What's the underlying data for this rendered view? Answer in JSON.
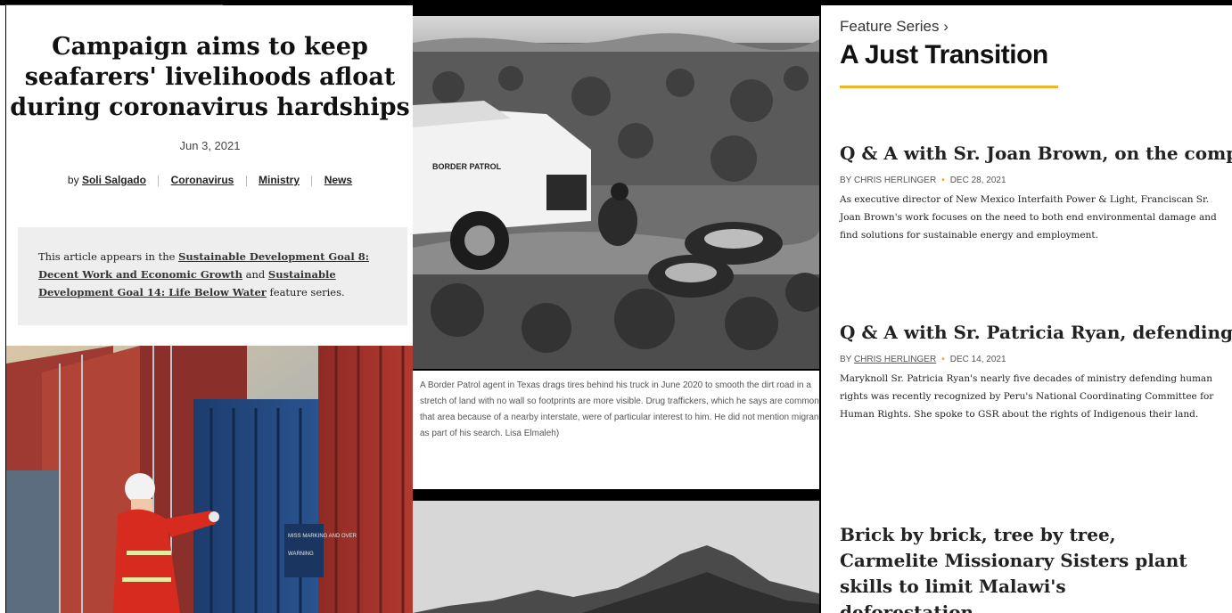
{
  "left_panel": {
    "headline": "Campaign aims to keep seafarers' livelihoods afloat during coronavirus hardships",
    "date": "Jun 3, 2021",
    "byline_prefix": "by",
    "author": "Soli Salgado",
    "tags": [
      "Coronavirus",
      "Ministry",
      "News"
    ],
    "notice": {
      "prefix": "This article appears in the",
      "link1": "Sustainable Development Goal 8: Decent Work and Economic Growth",
      "and": "and",
      "link2": "Sustainable Development Goal 14: Life Below Water",
      "suffix": "feature series."
    },
    "hero_text": {
      "sign1": "MISS MARKING AND OVER",
      "sign2": "WARNING"
    }
  },
  "middle_panel": {
    "truck_text": "BORDER PATROL",
    "caption": "A Border Patrol agent in Texas drags tires behind his truck in June 2020 to smooth the dirt road in a stretch of land with no wall so footprints are more visible. Drug traffickers, which he says are common in that area because of a nearby interstate, were of particular interest to him. He did not mention migrants as part of his search. Lisa Elmaleh)"
  },
  "right_panel": {
    "series_label": "Feature Series ›",
    "series_title": "A Just Transition",
    "accent_color": "#f0b429",
    "articles": [
      {
        "title": "Q & A with Sr. Joan Brown, on the complexities of the shift to sustainability",
        "author": "BY CHRIS HERLINGER",
        "date": "DEC 28, 2021",
        "excerpt": "As executive director of New Mexico Interfaith Power & Light, Franciscan Sr. Joan Brown's work focuses on the need to both end environmental damage and find solutions for sustainable energy and employment."
      },
      {
        "title": "Q & A with Sr. Patricia Ryan, defending Indigenous rights amid land exploitation",
        "author_prefix": "BY",
        "author_name": "CHRIS HERLINGER",
        "date": "DEC 14, 2021",
        "excerpt": "Maryknoll Sr. Patricia Ryan's nearly five decades of ministry defending human rights was recently recognized by Peru's National Coordinating Committee for Human Rights. She spoke to GSR about the rights of Indigenous their land."
      },
      {
        "title": "Brick by brick, tree by tree, Carmelite Missionary Sisters plant skills to limit Malawi's deforestation"
      }
    ]
  }
}
